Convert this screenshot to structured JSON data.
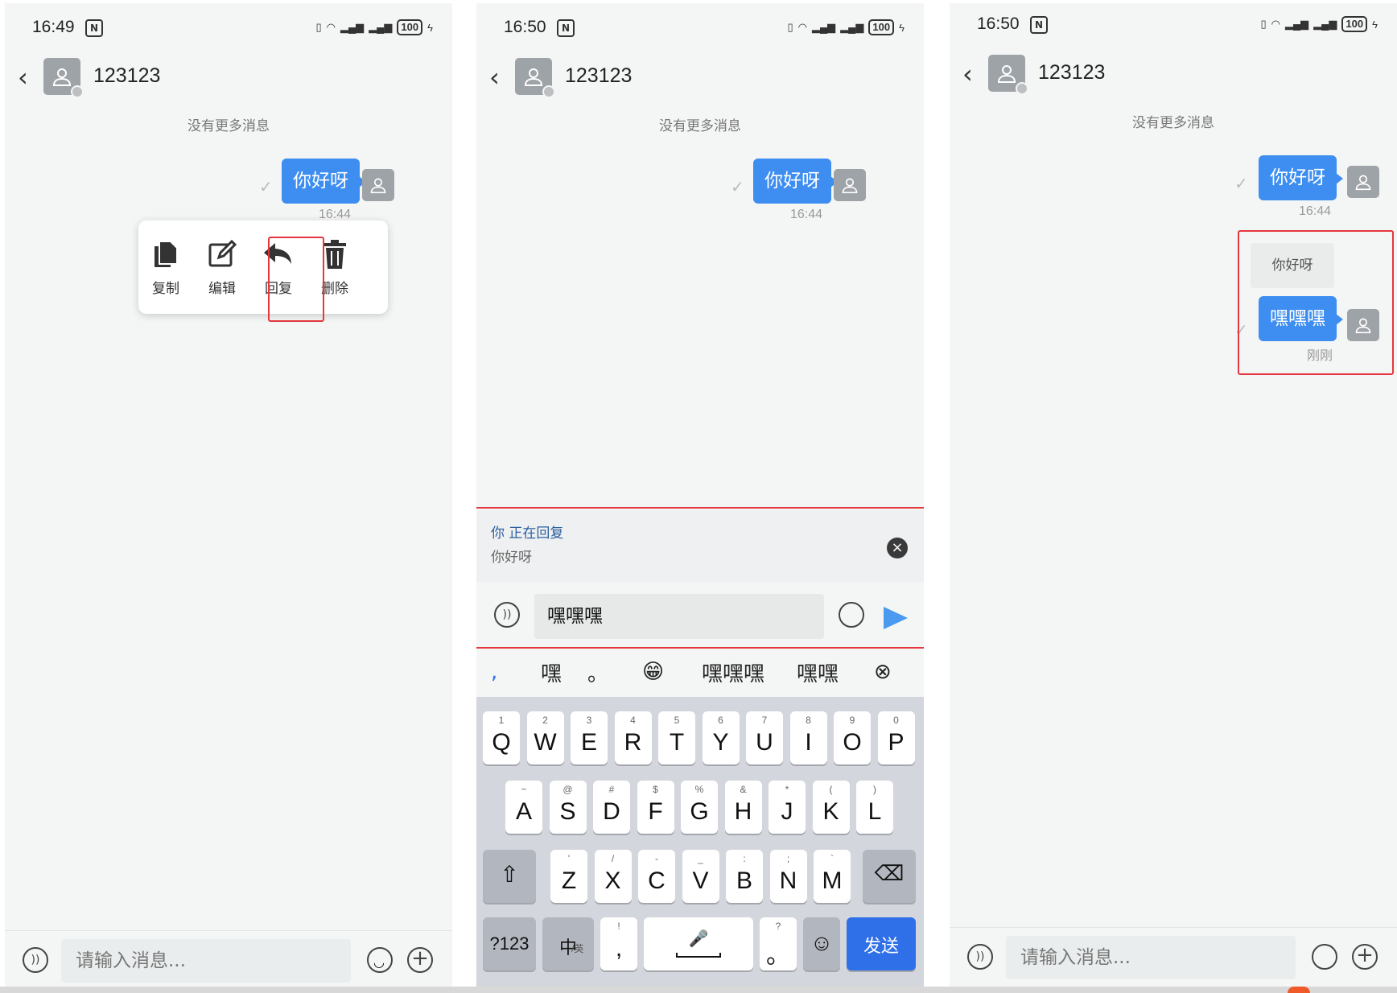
{
  "screens": [
    {
      "status": {
        "time": "16:49",
        "battery": "100"
      },
      "contact": "123123",
      "no_more": "没有更多消息",
      "message": {
        "text": "你好呀",
        "time": "16:44"
      },
      "menu": [
        {
          "label": "复制",
          "icon": "copy-icon"
        },
        {
          "label": "编辑",
          "icon": "edit-icon"
        },
        {
          "label": "回复",
          "icon": "reply-icon"
        },
        {
          "label": "删除",
          "icon": "trash-icon"
        }
      ],
      "input_placeholder": "请输入消息..."
    },
    {
      "status": {
        "time": "16:50",
        "battery": "100"
      },
      "contact": "123123",
      "no_more": "没有更多消息",
      "message": {
        "text": "你好呀",
        "time": "16:44"
      },
      "reply": {
        "title": "你 正在回复",
        "quote": "你好呀"
      },
      "input_value": "嘿嘿嘿",
      "candidates": [
        ",",
        "嘿",
        "。",
        "😁",
        "嘿嘿嘿",
        "嘿嘿",
        "⊗"
      ],
      "keyboard": {
        "row1": [
          [
            "1",
            "Q"
          ],
          [
            "2",
            "W"
          ],
          [
            "3",
            "E"
          ],
          [
            "4",
            "R"
          ],
          [
            "5",
            "T"
          ],
          [
            "6",
            "Y"
          ],
          [
            "7",
            "U"
          ],
          [
            "8",
            "I"
          ],
          [
            "9",
            "O"
          ],
          [
            "0",
            "P"
          ]
        ],
        "row2": [
          [
            "~",
            "A"
          ],
          [
            "@",
            "S"
          ],
          [
            "#",
            "D"
          ],
          [
            "$",
            "F"
          ],
          [
            "%",
            "G"
          ],
          [
            "&",
            "H"
          ],
          [
            "*",
            "J"
          ],
          [
            "(",
            "K"
          ],
          [
            ")",
            "L"
          ]
        ],
        "row3": [
          [
            "'",
            "Z"
          ],
          [
            "/",
            "X"
          ],
          [
            "-",
            "C"
          ],
          [
            "_",
            "V"
          ],
          [
            ":",
            "B"
          ],
          [
            ";",
            "N"
          ],
          [
            "`",
            "M"
          ]
        ],
        "num_key": "?123",
        "lang_key": "中",
        "lang_sub": "/英",
        "comma_sub": "!",
        "comma_main": ",",
        "period_sub": "?",
        "period_main": "。",
        "send_key": "发送"
      }
    },
    {
      "status": {
        "time": "16:50",
        "battery": "100"
      },
      "contact": "123123",
      "no_more": "没有更多消息",
      "message": {
        "text": "你好呀",
        "time": "16:44"
      },
      "reply_message": {
        "quote": "你好呀",
        "text": "嘿嘿嘿",
        "time": "刚刚"
      },
      "input_placeholder": "请输入消息..."
    }
  ],
  "colors": {
    "bubble": "#3d8ef0",
    "highlight": "#e5373d",
    "send_key": "#2f6fe8"
  }
}
